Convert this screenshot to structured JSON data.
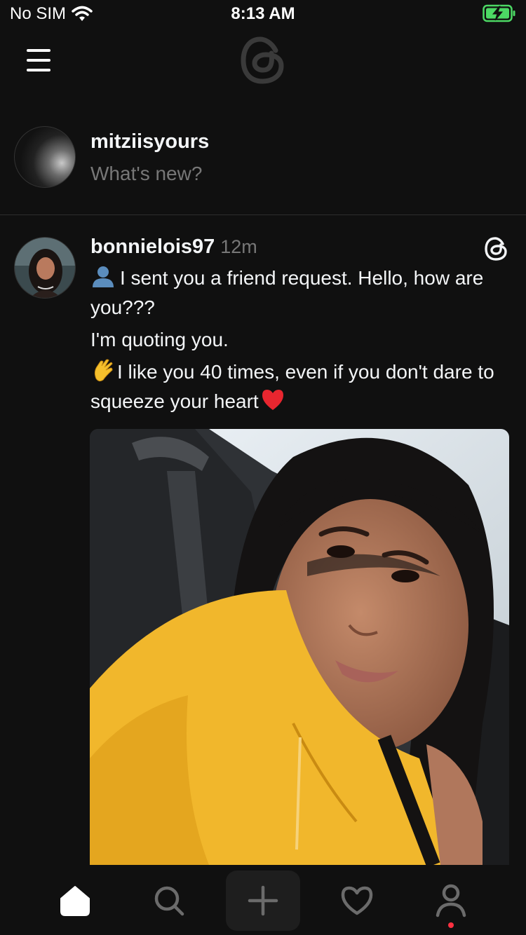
{
  "status_bar": {
    "carrier": "No SIM",
    "time": "8:13 AM"
  },
  "composer": {
    "username": "mitziisyours",
    "placeholder": "What's new?"
  },
  "post": {
    "username": "bonnielois97",
    "time_ago": "12m",
    "lines": [
      "I sent you a friend request. Hello, how are you???",
      "I'm quoting you.",
      "I like you 40 times, even if you don't dare to squeeze your heart"
    ]
  },
  "tabs": [
    {
      "name": "home",
      "icon": "home-icon",
      "active": true
    },
    {
      "name": "search",
      "icon": "search-icon"
    },
    {
      "name": "new-thread",
      "icon": "plus-icon"
    },
    {
      "name": "activity",
      "icon": "heart-icon"
    },
    {
      "name": "profile",
      "icon": "profile-icon",
      "badge_dot": true
    }
  ],
  "colors": {
    "background": "#101010",
    "text": "#f3f5f7",
    "muted": "#777777",
    "badge": "#ff3040"
  }
}
